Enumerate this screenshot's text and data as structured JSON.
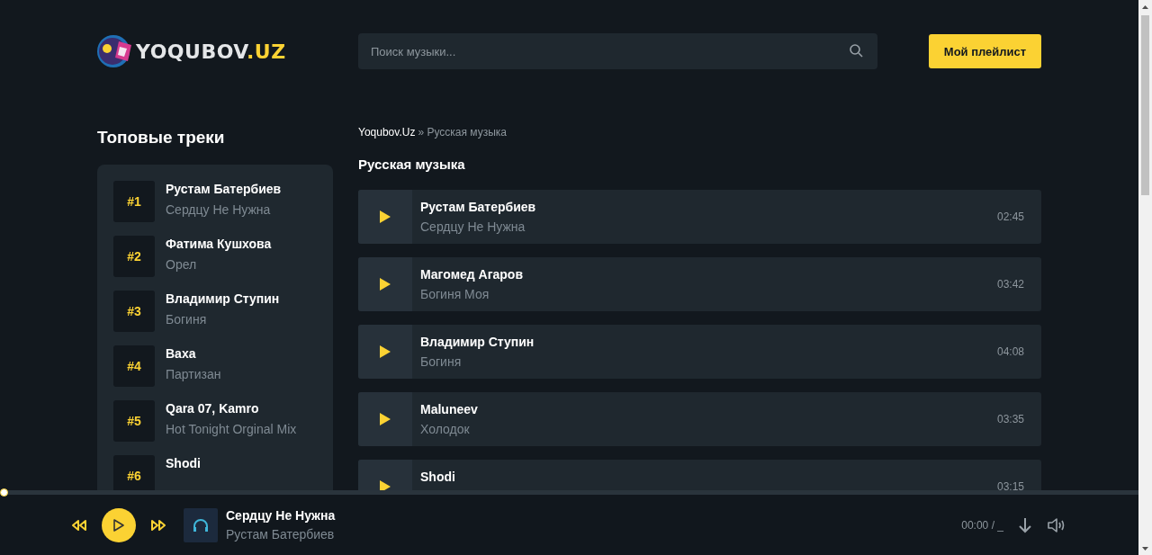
{
  "header": {
    "logo": {
      "text": "YOQUBOV",
      "suffix": ".UZ"
    },
    "search": {
      "placeholder": "Поиск музыки..."
    },
    "playlist_button": "Мой плейлист"
  },
  "sidebar": {
    "title": "Топовые треки",
    "tracks": [
      {
        "rank": "#1",
        "artist": "Рустам Батербиев",
        "title": "Сердцу Не Нужна"
      },
      {
        "rank": "#2",
        "artist": "Фатима Кушхова",
        "title": "Орел"
      },
      {
        "rank": "#3",
        "artist": "Владимир Ступин",
        "title": "Богиня"
      },
      {
        "rank": "#4",
        "artist": "Ваха",
        "title": "Партизан"
      },
      {
        "rank": "#5",
        "artist": "Qara 07, Kamro",
        "title": "Hot Tonight Orginal Mix"
      },
      {
        "rank": "#6",
        "artist": "Shodi"
      }
    ]
  },
  "main": {
    "breadcrumb": {
      "home": "Yoqubov.Uz",
      "separator": "»",
      "current": "Русская музыка"
    },
    "title": "Русская музыка",
    "tracks": [
      {
        "artist": "Рустам Батербиев",
        "title": "Сердцу Не Нужна",
        "duration": "02:45"
      },
      {
        "artist": "Магомед Агаров",
        "title": "Богиня Моя",
        "duration": "03:42"
      },
      {
        "artist": "Владимир Ступин",
        "title": "Богиня",
        "duration": "04:08"
      },
      {
        "artist": "Maluneev",
        "title": "Холодок",
        "duration": "03:35"
      },
      {
        "artist": "Shodi",
        "duration": "03:15"
      }
    ]
  },
  "player": {
    "progress": {
      "level": 0
    },
    "title": "Сердцу Не Нужна",
    "artist": "Рустам Батербиев",
    "time": "00:00",
    "separator": "/",
    "duration": "_"
  }
}
